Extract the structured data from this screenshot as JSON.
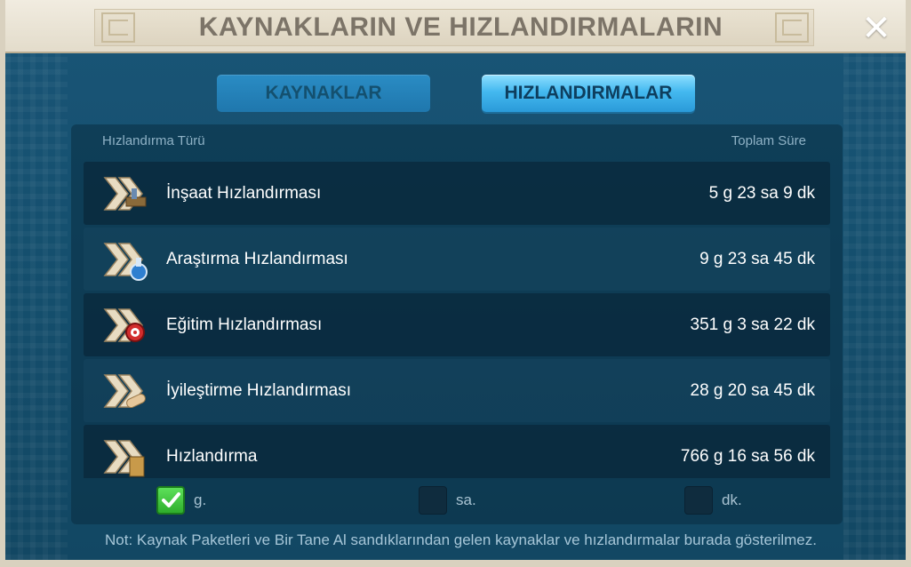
{
  "window": {
    "title": "KAYNAKLARIN VE HIZLANDIRMALARIN",
    "close_icon": "close-icon"
  },
  "tabs": [
    {
      "label": "KAYNAKLAR",
      "active": false
    },
    {
      "label": "HIZLANDIRMALAR",
      "active": true
    }
  ],
  "table": {
    "col_type": "Hızlandırma Türü",
    "col_total": "Toplam Süre",
    "rows": [
      {
        "label": "İnşaat Hızlandırması",
        "value": "5 g 23 sa 9 dk",
        "icon": "construction-speedup-icon"
      },
      {
        "label": "Araştırma Hızlandırması",
        "value": "9 g 23 sa 45 dk",
        "icon": "research-speedup-icon"
      },
      {
        "label": "Eğitim Hızlandırması",
        "value": "351 g 3 sa 22 dk",
        "icon": "training-speedup-icon"
      },
      {
        "label": "İyileştirme Hızlandırması",
        "value": "28 g 20 sa 45 dk",
        "icon": "healing-speedup-icon"
      },
      {
        "label": "Hızlandırma",
        "value": "766 g 16 sa 56 dk",
        "icon": "universal-speedup-icon"
      }
    ]
  },
  "filters": [
    {
      "label": "g.",
      "checked": true
    },
    {
      "label": "sa.",
      "checked": false
    },
    {
      "label": "dk.",
      "checked": false
    }
  ],
  "note": "Not: Kaynak Paketleri ve Bir Tane Al sandıklarından gelen kaynaklar ve hızlandırmalar burada gösterilmez.",
  "colors": {
    "accent": "#44b9f0",
    "check": "#3cc63a"
  }
}
